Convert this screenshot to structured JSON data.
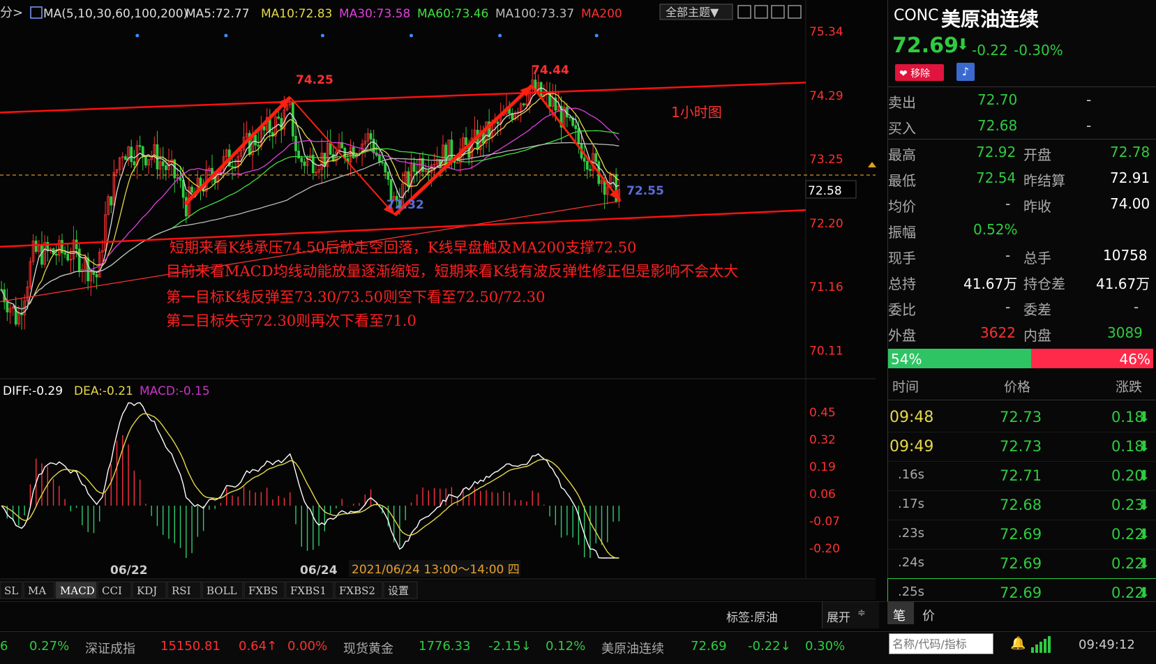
{
  "header": {
    "prefix": "分>",
    "ma_params": "MA(5,10,30,60,100,200)",
    "ma5": "MA5:72.77",
    "ma10": "MA10:72.83",
    "ma30": "MA30:73.58",
    "ma60": "MA60:73.46",
    "ma100": "MA100:73.37",
    "ma200": "MA200",
    "theme_button": "全部主题▼"
  },
  "price_axis": [
    "75.34",
    "74.29",
    "73.25",
    "72.20",
    "71.16",
    "70.11"
  ],
  "price_marker": "72.58",
  "annotations": {
    "peak1": "74.25",
    "peak2": "74.44",
    "trough1": "72.32",
    "trough2": "72.55",
    "timeframe": "1小时图",
    "line1": "短期来看K线承压74.50后就走空回落，K线早盘触及MA200支撑72.50",
    "line2": "目前来看MACD均线动能放量逐渐缩短，短期来看K线有波反弹性修正但是影响不会太大",
    "line3": "第一目标K线反弹至73.30/73.50则空下看至72.50/72.30",
    "line4": "第二目标失守72.30则再次下看至71.0"
  },
  "macd_header": {
    "diff": "DIFF:-0.29",
    "dea": "DEA:-0.21",
    "macd": "MACD:-0.15"
  },
  "macd_axis": [
    "0.45",
    "0.32",
    "0.19",
    "0.06",
    "-0.07",
    "-0.20"
  ],
  "date_axis": {
    "d1": "06/22",
    "d2": "06/24",
    "cursor_label": "2021/06/24 13:00～14:00 四"
  },
  "indicator_tabs": [
    "SL",
    "MA",
    "MACD",
    "CCI",
    "KDJ",
    "RSI",
    "BOLL",
    "FXBS",
    "FXBS1",
    "FXBS2",
    "设置"
  ],
  "active_tab": "MACD",
  "quote": {
    "code": "CONC",
    "name": "美原油连续",
    "price": "72.69",
    "change": "-0.22",
    "change_pct": "-0.30%",
    "remove_label": "移除",
    "ask_label": "卖出",
    "ask": "72.70",
    "ask_vol": "-",
    "bid_label": "买入",
    "bid": "72.68",
    "bid_vol": "-",
    "high_label": "最高",
    "high": "72.92",
    "open_label": "开盘",
    "open": "72.78",
    "low_label": "最低",
    "low": "72.54",
    "prev_settle_label": "昨结算",
    "prev_settle": "72.91",
    "avg_label": "均价",
    "avg": "-",
    "prev_close_label": "昨收",
    "prev_close": "74.00",
    "amp_label": "振幅",
    "amp": "0.52%",
    "cur_vol_label": "现手",
    "cur_vol": "-",
    "total_vol_label": "总手",
    "total_vol": "10758",
    "oi_label": "总持",
    "oi": "41.67万",
    "oi_diff_label": "持仓差",
    "oi_diff": "41.67万",
    "ratio_label": "委比",
    "ratio": "-",
    "diff_label": "委差",
    "diff": "-",
    "outer_label": "外盘",
    "outer": "3622",
    "inner_label": "内盘",
    "inner": "3089",
    "buy_pct": "54%",
    "sell_pct": "46%",
    "buy_fraction": 0.54
  },
  "ticks_header": {
    "time": "时间",
    "price": "价格",
    "change": "涨跌"
  },
  "ticks": [
    {
      "time": "09:48",
      "price": "72.73",
      "change": "0.18"
    },
    {
      "time": "09:49",
      "price": "72.73",
      "change": "0.18"
    },
    {
      "time": ".16s",
      "price": "72.71",
      "change": "0.20"
    },
    {
      "time": ".17s",
      "price": "72.68",
      "change": "0.23"
    },
    {
      "time": ".23s",
      "price": "72.69",
      "change": "0.22"
    },
    {
      "time": ".24s",
      "price": "72.69",
      "change": "0.22"
    },
    {
      "time": ".25s",
      "price": "72.69",
      "change": "0.22"
    }
  ],
  "bottom": {
    "tag": "标签:原油",
    "expand": "展开",
    "tab_bi": "笔",
    "tab_jia": "价",
    "search_placeholder": "名称/代码/指标",
    "clock": "09:49:12"
  },
  "ticker": [
    {
      "text": "6",
      "color": "#2ecc40"
    },
    {
      "text": "0.27%",
      "color": "#2ecc40"
    },
    {
      "text": "深证成指",
      "color": "#aaaaaa"
    },
    {
      "text": "15150.81",
      "color": "#ff3030"
    },
    {
      "text": "0.64↑",
      "color": "#ff3030"
    },
    {
      "text": "0.00%",
      "color": "#ff3030"
    },
    {
      "text": "现货黄金",
      "color": "#aaaaaa"
    },
    {
      "text": "1776.33",
      "color": "#2ecc40"
    },
    {
      "text": "-2.15↓",
      "color": "#2ecc40"
    },
    {
      "text": "0.12%",
      "color": "#2ecc40"
    },
    {
      "text": "美原油连续",
      "color": "#aaaaaa"
    },
    {
      "text": "72.69",
      "color": "#2ecc40"
    },
    {
      "text": "-0.22↓",
      "color": "#2ecc40"
    },
    {
      "text": "0.30%",
      "color": "#2ecc40"
    }
  ],
  "chart_data": {
    "type": "line",
    "title": "",
    "price_range": [
      69.9,
      75.5
    ],
    "channel": {
      "upper": [
        {
          "x": 0,
          "y": 74.0
        },
        {
          "x": 1,
          "y": 74.49
        }
      ],
      "lower": [
        {
          "x": 0,
          "y": 71.8
        },
        {
          "x": 1,
          "y": 72.4
        }
      ]
    },
    "zigzag": [
      {
        "label": "start",
        "y": 72.5,
        "xfrac": 0.23
      },
      {
        "label": "74.25",
        "y": 74.25,
        "xfrac": 0.36
      },
      {
        "label": "72.32",
        "y": 72.32,
        "xfrac": 0.49
      },
      {
        "label": "74.44",
        "y": 74.44,
        "xfrac": 0.66
      },
      {
        "label": "72.55",
        "y": 72.55,
        "xfrac": 0.77
      }
    ],
    "macd_range": [
      -0.25,
      0.5
    ],
    "series": [
      {
        "name": "DIFF",
        "color": "#ffffff"
      },
      {
        "name": "DEA",
        "color": "#e6d84a"
      },
      {
        "name": "MACD",
        "color": "#cc33cc"
      }
    ]
  }
}
